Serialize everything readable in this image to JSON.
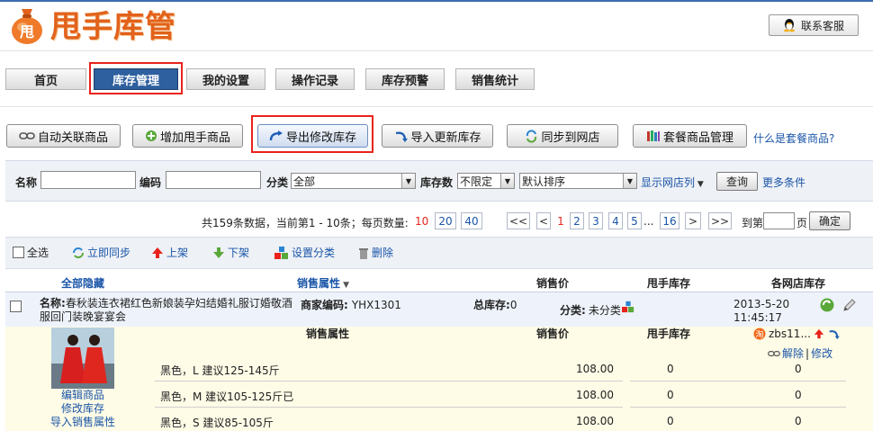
{
  "brand": {
    "name": "甩手库管",
    "bag_char": "甩"
  },
  "header": {
    "contact_label": "联系客服"
  },
  "nav": {
    "tabs": [
      {
        "label": "首页"
      },
      {
        "label": "库存管理"
      },
      {
        "label": "我的设置"
      },
      {
        "label": "操作记录"
      },
      {
        "label": "库存预警"
      },
      {
        "label": "销售统计"
      }
    ]
  },
  "actions": {
    "auto_link": "自动关联商品",
    "add_product": "增加甩手商品",
    "export": "导出修改库存",
    "import": "导入更新库存",
    "sync_shop": "同步到网店",
    "bundle": "套餐商品管理",
    "bundle_help": "什么是套餐商品?"
  },
  "search": {
    "name_label": "名称",
    "name_value": "",
    "code_label": "编码",
    "code_value": "",
    "category_label": "分类",
    "category_value": "全部",
    "stock_label": "库存数",
    "stock_value": "不限定",
    "sort_value": "默认排序",
    "show_shops": "显示网店列",
    "query_btn": "查询",
    "more": "更多条件"
  },
  "pager": {
    "summary": "共159条数据，当前第1 - 10条；每页数量:",
    "sizes": [
      "10",
      "20",
      "40"
    ],
    "first": "<<",
    "prev": "<",
    "pages": [
      "1",
      "2",
      "3",
      "4",
      "5"
    ],
    "ellipsis": "...",
    "last_page": "16",
    "next": ">",
    "end": ">>",
    "goto_label": "到第",
    "goto_value": "",
    "page_unit": "页",
    "confirm": "确定"
  },
  "toolbar": {
    "select_all": "全选",
    "sync_now": "立即同步",
    "list_up": "上架",
    "list_down": "下架",
    "set_category": "设置分类",
    "delete": "删除"
  },
  "table": {
    "col_hide": "全部隐藏",
    "col_attr": "销售属性",
    "col_price": "销售价",
    "col_stock": "甩手库存",
    "col_shop_stock": "各网店库存"
  },
  "product": {
    "name_label": "名称:",
    "name": "春秋装连衣裙红色新娘装孕妇结婚礼服订婚敬酒服回门装晚宴宴会",
    "code_label": "商家编码:",
    "code": "YHX1301",
    "total_label": "总库存:",
    "total": "0",
    "category_label": "分类:",
    "category": "未分类",
    "date": "2013-5-20",
    "time": "11:45:17",
    "edit_link": "编辑商品",
    "edit_stock_link": "修改库存",
    "import_attr_link": "导入销售属性",
    "sub_attr": "销售属性",
    "sub_price": "销售价",
    "sub_stock": "甩手库存",
    "shop_name": "zbs11...",
    "unlink": "解除",
    "modify": "修改",
    "variants": [
      {
        "attr": "黑色，L 建议125-145斤",
        "price": "108.00",
        "stock": "0",
        "shop_stock": "0"
      },
      {
        "attr": "黑色，M 建议105-125斤已",
        "price": "108.00",
        "stock": "0",
        "shop_stock": "0"
      },
      {
        "attr": "黑色，S 建议85-105斤",
        "price": "108.00",
        "stock": "0",
        "shop_stock": "0"
      }
    ]
  }
}
